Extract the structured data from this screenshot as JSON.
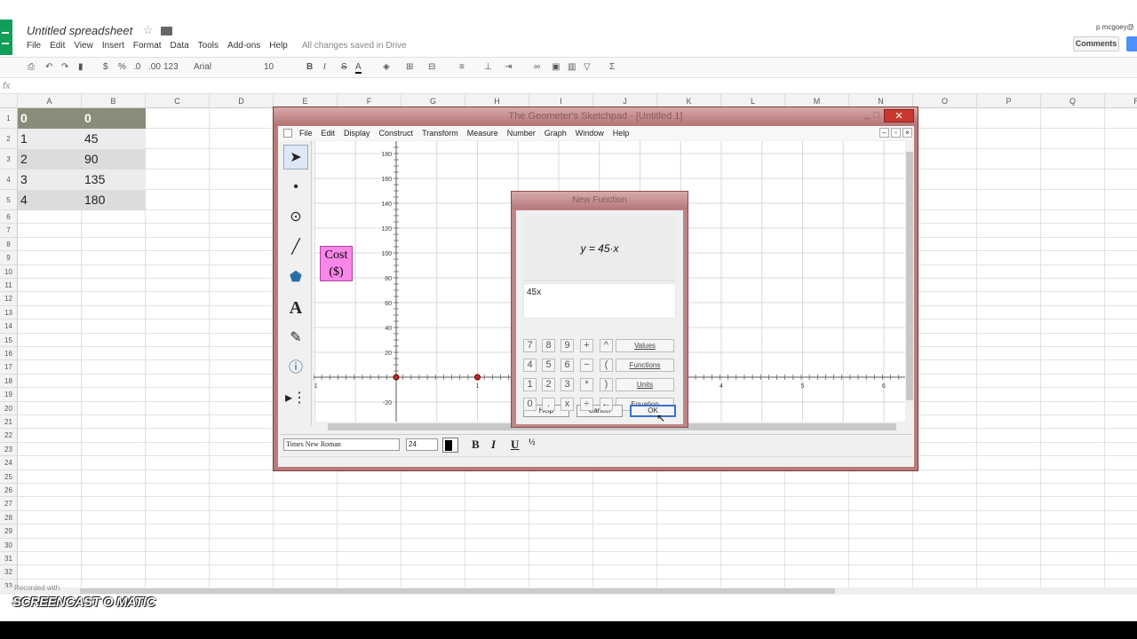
{
  "app": {
    "doc_title": "Untitled spreadsheet",
    "user_email": "p mcgoey@",
    "comments_label": "Comments",
    "menu": [
      "File",
      "Edit",
      "View",
      "Insert",
      "Format",
      "Data",
      "Tools",
      "Add-ons",
      "Help"
    ],
    "save_status": "All changes saved in Drive"
  },
  "toolbar": {
    "currency": "$",
    "percent": "%",
    "dec_less": ".0",
    "dec_more": ".00",
    "more_formats": "123",
    "font": "Arial",
    "font_size": "10",
    "bold": "B",
    "italic": "I",
    "text_color": "A",
    "sigma": "Σ"
  },
  "formula_bar": {
    "label": "fx",
    "value": ""
  },
  "sheet": {
    "columns": [
      "A",
      "B",
      "C",
      "D",
      "E",
      "F",
      "G",
      "H",
      "I",
      "J",
      "K",
      "L",
      "M",
      "N",
      "O",
      "P",
      "Q",
      "R"
    ],
    "rows": [
      "1",
      "2",
      "3",
      "4",
      "5",
      "6",
      "7",
      "8",
      "9",
      "10",
      "11",
      "12",
      "13",
      "14",
      "15",
      "16",
      "17",
      "18",
      "19",
      "20",
      "21",
      "22",
      "23",
      "24",
      "25",
      "26",
      "27",
      "28",
      "29",
      "30",
      "31",
      "32",
      "33"
    ],
    "data": [
      [
        "0",
        "0"
      ],
      [
        "1",
        "45"
      ],
      [
        "2",
        "90"
      ],
      [
        "3",
        "135"
      ],
      [
        "4",
        "180"
      ]
    ]
  },
  "gsp": {
    "title": "The Geometer's Sketchpad - [Untitled 1]",
    "close": "✕",
    "menu": [
      "File",
      "Edit",
      "Display",
      "Construct",
      "Transform",
      "Measure",
      "Number",
      "Graph",
      "Window",
      "Help"
    ],
    "cost_label_line1": "Cost",
    "cost_label_line2": "($)",
    "y_ticks": [
      "180",
      "160",
      "140",
      "120",
      "100",
      "80",
      "60",
      "40",
      "20",
      "-20"
    ],
    "x_ticks": [
      "-1",
      "1",
      "2",
      "3",
      "4",
      "5",
      "6"
    ],
    "font_name": "Times New Roman",
    "font_size": "24",
    "fmt_bold": "B",
    "fmt_italic": "I",
    "fmt_underline": "U"
  },
  "dialog": {
    "title": "New Function",
    "preview": "y = 45·x",
    "expression": "45x",
    "keys": [
      "7",
      "8",
      "9",
      "+",
      "^",
      "4",
      "5",
      "6",
      "−",
      "(",
      "1",
      "2",
      "3",
      "*",
      ")",
      "0",
      ".",
      "x",
      "÷",
      "←"
    ],
    "values_label": "Values",
    "functions_label": "Functions",
    "units_label": "Units",
    "equation_label": "Equation",
    "help_label": "Help",
    "cancel_label": "Cancel",
    "ok_label": "OK"
  },
  "watermark": {
    "small": "Recorded with",
    "brand": "SCREENCAST O MATIC"
  }
}
